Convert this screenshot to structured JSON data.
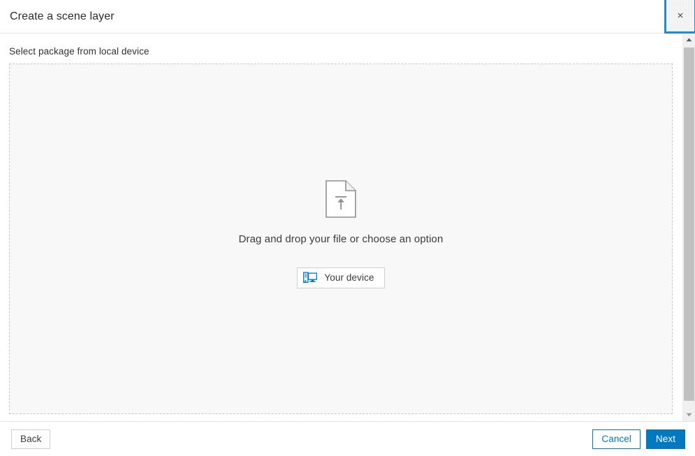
{
  "dialog": {
    "title": "Create a scene layer",
    "close_label": "×",
    "close_icon": "close-icon"
  },
  "body": {
    "section_label": "Select package from local device",
    "dropzone": {
      "file_upload_icon": "file-upload-icon",
      "prompt": "Drag and drop your file or choose an option",
      "device_button": {
        "label": "Your device",
        "icon": "desktop-computer-icon"
      },
      "background_color": "#f8f8f8",
      "border_color": "#c8c8c8"
    }
  },
  "scrollbar": {
    "up_arrow_icon": "chevron-up-icon",
    "down_arrow_icon": "chevron-down-icon",
    "track_color": "#f0f0f0",
    "thumb_color": "#c1c1c1"
  },
  "footer": {
    "back_label": "Back",
    "cancel_label": "Cancel",
    "next_label": "Next"
  },
  "colors": {
    "accent_blue": "#0079c1",
    "focus_blue": "#1f8ad2",
    "divider": "#e4e4e4",
    "text": "#323232"
  }
}
